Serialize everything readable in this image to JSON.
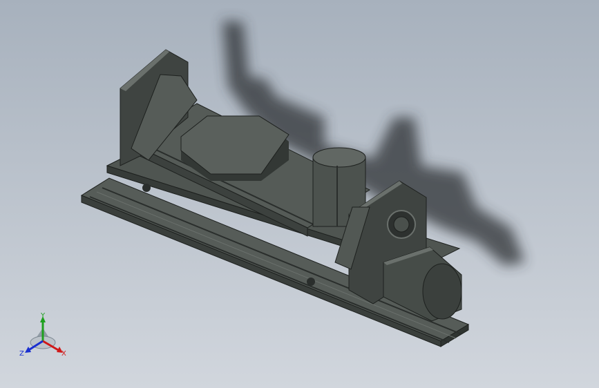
{
  "viewport": {
    "background_top": "#a7b1bd",
    "background_bottom": "#d1d6dd"
  },
  "model": {
    "body_color": "#4a514d",
    "shadow_color": "#333"
  },
  "triad": {
    "x_label": "X",
    "y_label": "Y",
    "z_label": "Z",
    "x_color": "#d01818",
    "y_color": "#1ea01e",
    "z_color": "#1a2fd0"
  }
}
